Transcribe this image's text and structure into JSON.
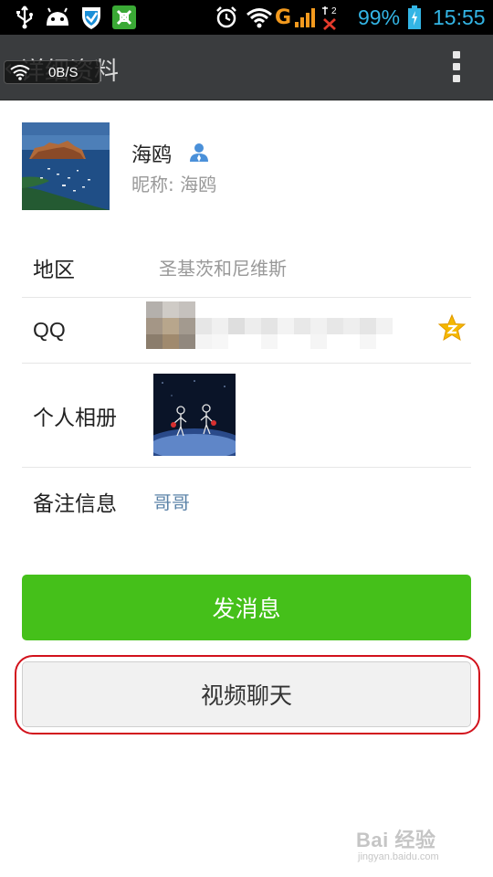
{
  "status_bar": {
    "battery_percent": "99%",
    "time": "15:55",
    "network_type": "G",
    "sim_slot": "2",
    "icons": [
      "usb-icon",
      "android-icon",
      "shield-icon",
      "app-icon",
      "alarm-icon",
      "wifi-icon",
      "signal-icon",
      "sim-error-icon",
      "battery-icon"
    ]
  },
  "action_bar": {
    "title": "详细资料",
    "speed_overlay": "0B/S",
    "menu_icon": "overflow-menu-icon"
  },
  "profile": {
    "name": "海鸥",
    "nickname_label": "昵称:",
    "nickname": "海鸥"
  },
  "details": {
    "region_label": "地区",
    "region_value": "圣基茨和尼维斯",
    "qq_label": "QQ",
    "album_label": "个人相册",
    "note_label": "备注信息",
    "note_value": "哥哥"
  },
  "actions": {
    "send_message": "发消息",
    "video_chat": "视频聊天"
  },
  "watermark": {
    "text": "Bai 经验",
    "url": "jingyan.baidu.com"
  },
  "colors": {
    "accent_green": "#45c01a",
    "status_blue": "#33b5e5",
    "action_bar": "#3a3c3e",
    "note_link": "#5b83a8",
    "highlight_red": "#d2121c"
  }
}
